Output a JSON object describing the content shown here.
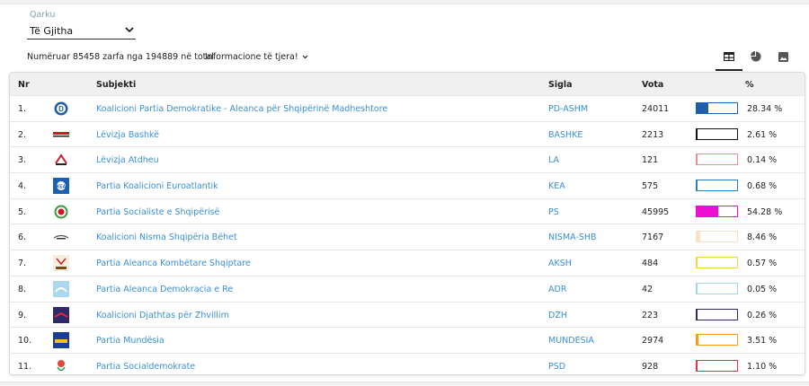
{
  "filter": {
    "label": "Qarku",
    "selected": "Të Gjitha"
  },
  "summary": {
    "counted_text": "Numëruar 85458 zarfa nga 194889 në total",
    "more_info_label": "Informacione të tjera!"
  },
  "view_icons": [
    "table-icon",
    "pie-chart-icon",
    "image-icon"
  ],
  "table": {
    "headers": {
      "nr": "Nr",
      "subject": "Subjekti",
      "sigla": "Sigla",
      "votes": "Vota",
      "percent": "%"
    },
    "rows": [
      {
        "nr": "1.",
        "name": "Koalicioni Partia Demokratike - Aleanca për Shqipërinë Madheshtore",
        "sigla": "PD-ASHM",
        "votes": "24011",
        "percent_label": "28.34 %",
        "share": 0.2834,
        "color": "#1f5fa8",
        "logo": "pd-logo"
      },
      {
        "nr": "2.",
        "name": "Lëvizja Bashkë",
        "sigla": "BASHKE",
        "votes": "2213",
        "percent_label": "2.61 %",
        "share": 0.0261,
        "color": "#111111",
        "logo": "bashke-logo"
      },
      {
        "nr": "3.",
        "name": "Lëvizja Atdheu",
        "sigla": "LA",
        "votes": "121",
        "percent_label": "0.14 %",
        "share": 0.0014,
        "color": "#f08a9a",
        "logo": "la-logo"
      },
      {
        "nr": "4.",
        "name": "Partia Koalicioni Euroatlantik",
        "sigla": "KEA",
        "votes": "575",
        "percent_label": "0.68 %",
        "share": 0.0068,
        "color": "#2a80c8",
        "logo": "kea-logo"
      },
      {
        "nr": "5.",
        "name": "Partia Socialiste e Shqipërisë",
        "sigla": "PS",
        "votes": "45995",
        "percent_label": "54.28 %",
        "share": 0.5428,
        "color": "#ee10d0",
        "logo": "ps-logo"
      },
      {
        "nr": "6.",
        "name": "Koalicioni Nisma Shqipëria Bëhet",
        "sigla": "NISMA-SHB",
        "votes": "7167",
        "percent_label": "8.46 %",
        "share": 0.0846,
        "color": "#f7e2c8",
        "logo": "nisma-logo"
      },
      {
        "nr": "7.",
        "name": "Partia Aleanca Kombëtare Shqiptare",
        "sigla": "AKSH",
        "votes": "484",
        "percent_label": "0.57 %",
        "share": 0.0057,
        "color": "#f2d63a",
        "logo": "aksh-logo"
      },
      {
        "nr": "8.",
        "name": "Partia Aleanca Demokracia e Re",
        "sigla": "ADR",
        "votes": "42",
        "percent_label": "0.05 %",
        "share": 0.0005,
        "color": "#9fd8ee",
        "logo": "adr-logo"
      },
      {
        "nr": "9.",
        "name": "Koalicioni Djathtas për Zhvillim",
        "sigla": "DZH",
        "votes": "223",
        "percent_label": "0.26 %",
        "share": 0.0026,
        "color": "#2d2a6a",
        "logo": "dzh-logo"
      },
      {
        "nr": "10.",
        "name": "Partia Mundësia",
        "sigla": "MUNDESIA",
        "votes": "2974",
        "percent_label": "3.51 %",
        "share": 0.0351,
        "color": "#f49b1c",
        "logo": "mundesia-logo"
      },
      {
        "nr": "11.",
        "name": "Partia Socialdemokrate",
        "sigla": "PSD",
        "votes": "928",
        "percent_label": "1.10 %",
        "share": 0.011,
        "color": "#e2334a",
        "logo": "psd-logo"
      }
    ]
  }
}
